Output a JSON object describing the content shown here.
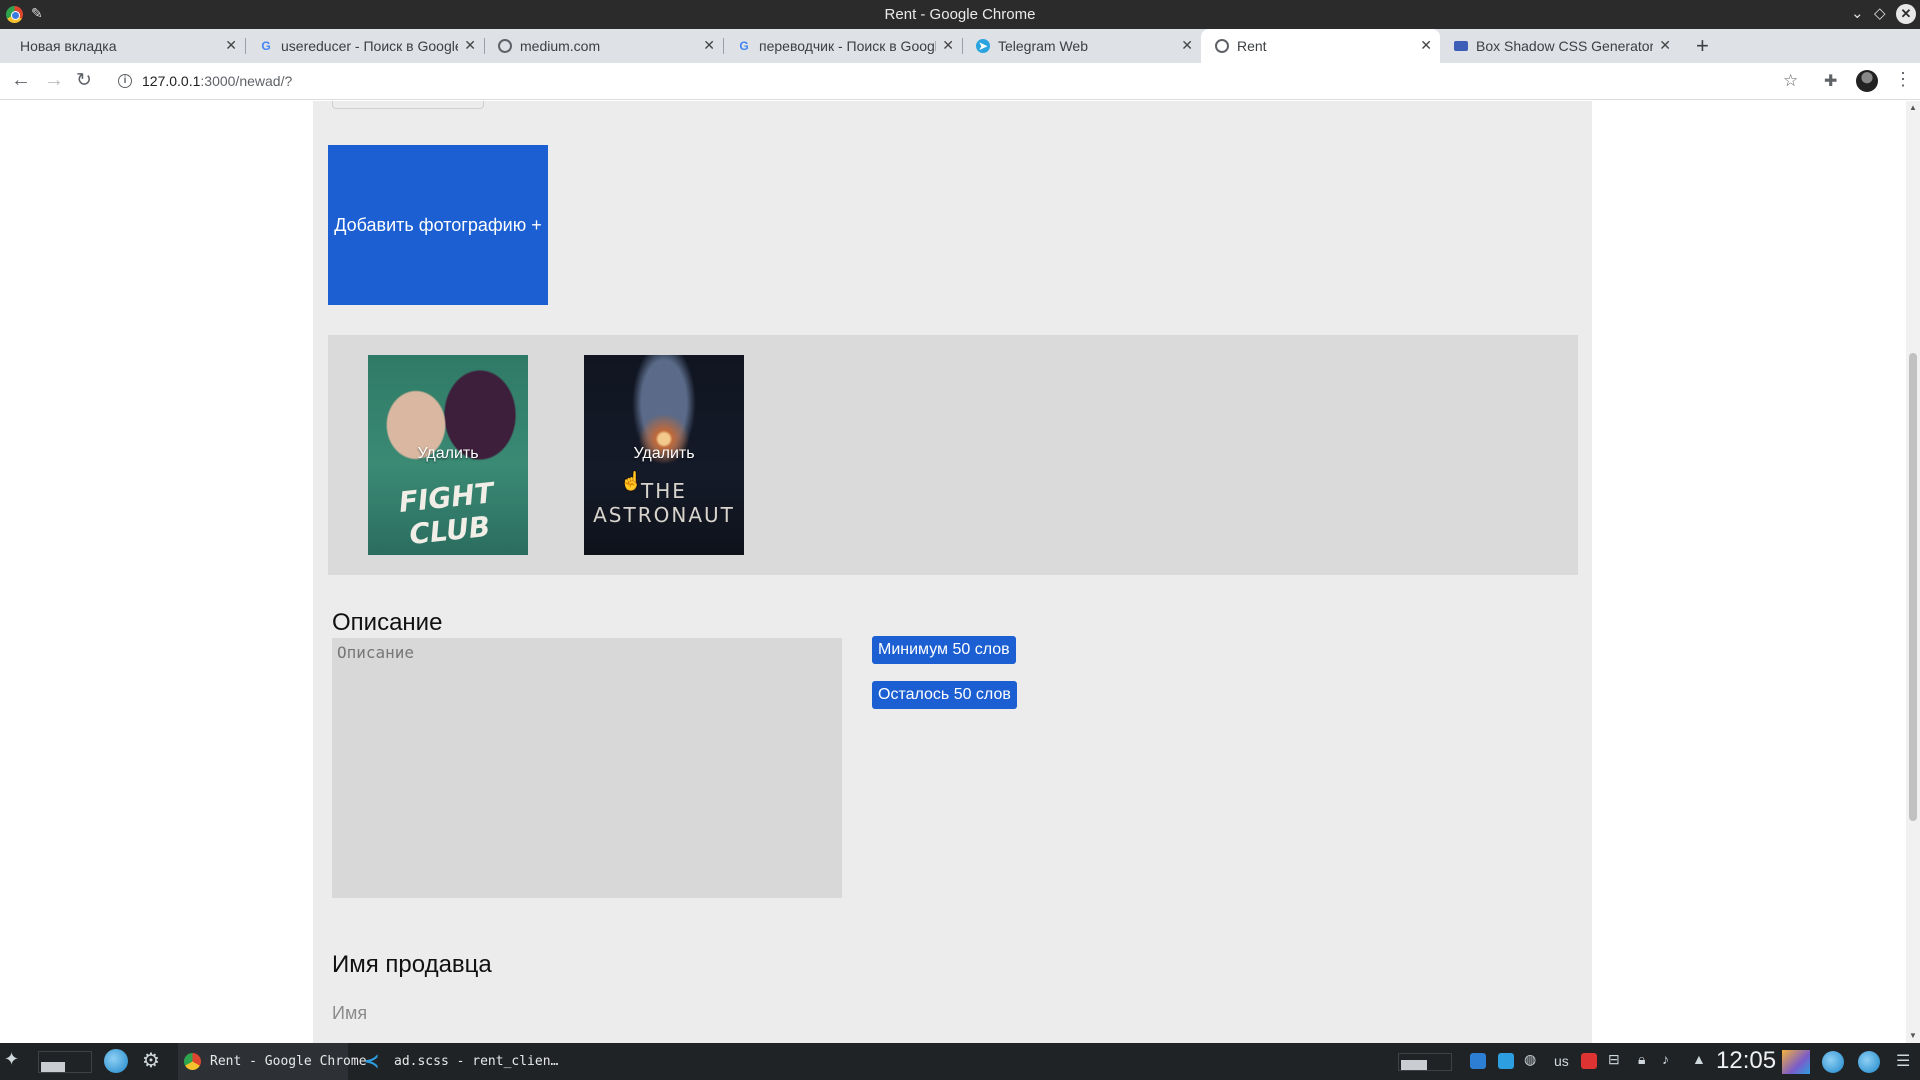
{
  "window": {
    "title": "Rent - Google Chrome"
  },
  "tabs": [
    {
      "label": "Новая вкладка",
      "icon": "none",
      "active": false
    },
    {
      "label": "usereducer - Поиск в Google",
      "icon": "google-icon",
      "active": false
    },
    {
      "label": "medium.com",
      "icon": "globe-icon",
      "active": false
    },
    {
      "label": "переводчик - Поиск в Google",
      "icon": "google-icon",
      "active": false
    },
    {
      "label": "Telegram Web",
      "icon": "telegram-icon",
      "active": false
    },
    {
      "label": "Rent",
      "icon": "globe-icon",
      "active": true
    },
    {
      "label": "Box Shadow CSS Generator",
      "icon": "box-icon",
      "active": false
    }
  ],
  "address_bar": {
    "host": "127.0.0.1",
    "path": ":3000/newad/?"
  },
  "page": {
    "add_photo_label": "Добавить фотографию +",
    "photos": [
      {
        "delete_label": "Удалить",
        "poster_text": "FIGHT CLUB"
      },
      {
        "delete_label": "Удалить",
        "poster_text": "THE ASTRONAUT"
      }
    ],
    "description": {
      "title": "Описание",
      "placeholder": "Описание",
      "min_words_label": "Минимум 50 слов",
      "words_left_label": "Осталось 50 слов"
    },
    "seller": {
      "title": "Имя продавца",
      "placeholder": "Имя"
    }
  },
  "taskbar": {
    "chrome_label": "Rent - Google Chrome",
    "vscode_label": "ad.scss - rent_clien…",
    "keyboard_layout": "us",
    "clock": "12:05"
  },
  "colors": {
    "accent_blue": "#1b5fd2",
    "page_background": "#ececec",
    "gallery_background": "#dadada"
  }
}
